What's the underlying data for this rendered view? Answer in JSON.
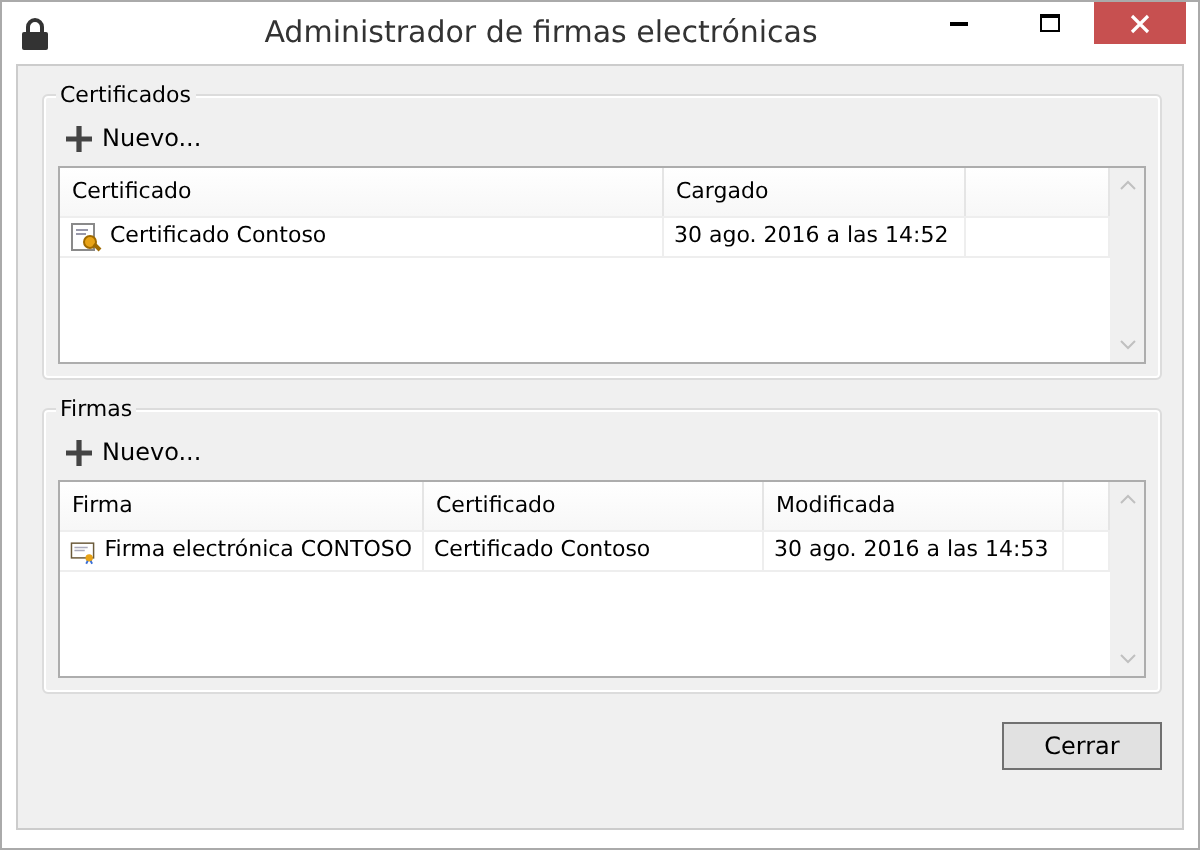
{
  "window": {
    "title": "Administrador de firmas electrónicas"
  },
  "groups": [
    {
      "title": "Certificados",
      "new_button": "Nuevo...",
      "columns": [
        "Certificado",
        "Cargado"
      ],
      "rows": [
        {
          "cells": [
            "Certificado Contoso",
            "30 ago. 2016 a las 14:52"
          ]
        }
      ]
    },
    {
      "title": "Firmas",
      "new_button": "Nuevo...",
      "columns": [
        "Firma",
        "Certificado",
        "Modificada"
      ],
      "rows": [
        {
          "cells": [
            "Firma electrónica CONTOSO",
            "Certificado Contoso",
            "30 ago. 2016 a las 14:53"
          ]
        }
      ]
    }
  ],
  "close_button": "Cerrar"
}
